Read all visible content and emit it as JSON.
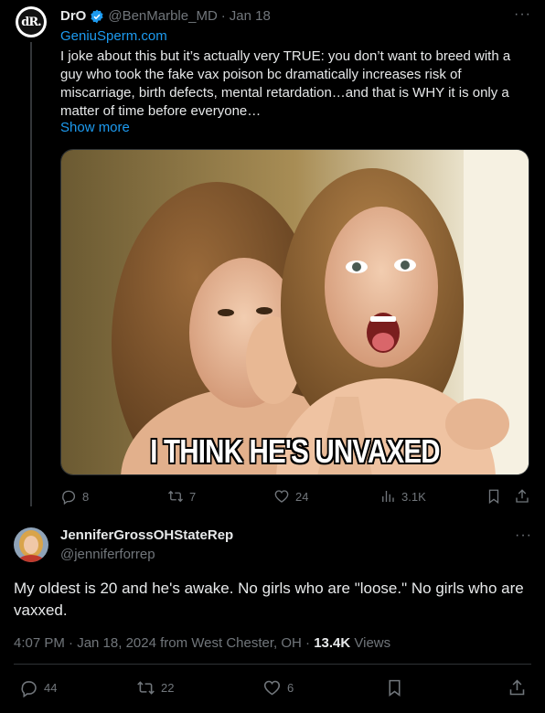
{
  "original_tweet": {
    "display_name": "DrO",
    "handle": "@BenMarble_MD",
    "date": "Jan 18",
    "separator": "·",
    "link": "GeniuSperm.com",
    "text": "I joke about this but it’s actually very TRUE: you don’t want to breed with a guy who took the fake vax poison bc dramatically increases risk of miscarriage, birth defects, mental retardation…and that is WHY it is only a matter of time before everyone…",
    "show_more": "Show more",
    "media_caption": "I THINK HE'S UNVAXED",
    "avatar_text": "dR.",
    "replies": "8",
    "reposts": "7",
    "likes": "24",
    "views": "3.1K",
    "more": "···"
  },
  "reply_tweet": {
    "display_name": "JenniferGrossOHStateRep",
    "handle": "@jenniferforrep",
    "text": "My oldest is 20 and he's awake. No girls who are \"loose.\" No girls who are vaxxed.",
    "timestamp": "4:07 PM · Jan 18, 2024 from West Chester, OH · ",
    "views_count": "13.4K",
    "views_label": " Views",
    "replies": "44",
    "reposts": "22",
    "likes": "6",
    "more": "···"
  },
  "colors": {
    "background": "#000000",
    "text": "#e7e9ea",
    "muted": "#71767b",
    "link": "#1d9bf0",
    "verified": "#1d9bf0",
    "divider": "#2f3336"
  },
  "icons": [
    "reply-icon",
    "repost-icon",
    "like-icon",
    "views-icon",
    "bookmark-icon",
    "share-icon",
    "verified-badge-icon"
  ]
}
